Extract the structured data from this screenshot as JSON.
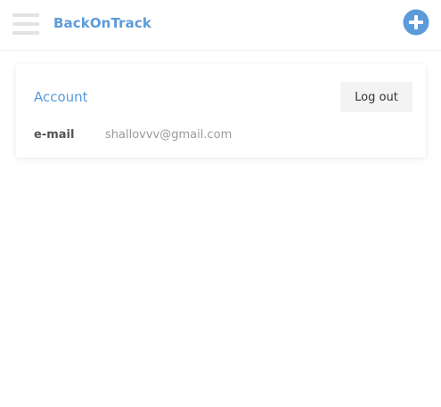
{
  "header": {
    "app_title": "BackOnTrack",
    "menu_icon": "hamburger-menu-icon",
    "add_icon": "plus-circle-icon"
  },
  "account": {
    "title": "Account",
    "logout_label": "Log out",
    "email_label": "e-mail",
    "email_value": "shallovvv@gmail.com"
  },
  "colors": {
    "accent": "#5b9bd9",
    "menu_icon": "#e3e3e3",
    "button_bg": "#f3f3f3"
  }
}
